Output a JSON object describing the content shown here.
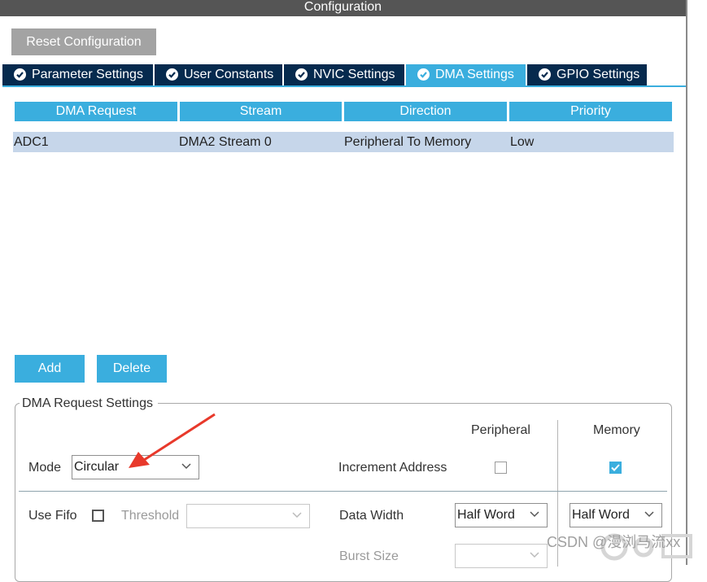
{
  "window": {
    "title": "Configuration"
  },
  "actions": {
    "reset_label": "Reset Configuration"
  },
  "tabs": [
    {
      "label": "Parameter Settings",
      "active": false
    },
    {
      "label": "User Constants",
      "active": false
    },
    {
      "label": "NVIC Settings",
      "active": false
    },
    {
      "label": "DMA Settings",
      "active": true
    },
    {
      "label": "GPIO Settings",
      "active": false
    }
  ],
  "dma_table": {
    "headers": [
      "DMA Request",
      "Stream",
      "Direction",
      "Priority"
    ],
    "rows": [
      {
        "request": "ADC1",
        "stream": "DMA2 Stream 0",
        "direction": "Peripheral To Memory",
        "priority": "Low"
      }
    ]
  },
  "table_buttons": {
    "add_label": "Add",
    "delete_label": "Delete"
  },
  "request_settings": {
    "title": "DMA Request Settings",
    "peripheral_header": "Peripheral",
    "memory_header": "Memory",
    "mode_label": "Mode",
    "mode_value": "Circular",
    "increment_label": "Increment Address",
    "increment_peripheral": false,
    "increment_memory": true,
    "use_fifo_label": "Use Fifo",
    "use_fifo": false,
    "threshold_label": "Threshold",
    "threshold_value": "",
    "data_width_label": "Data Width",
    "data_width_peripheral": "Half Word",
    "data_width_memory": "Half Word",
    "burst_size_label": "Burst Size",
    "burst_size_value": ""
  },
  "watermark": {
    "text": "CSDN @漫浏马流xx"
  },
  "colors": {
    "accent": "#3aaede",
    "tab_dark": "#062a4e",
    "selected_row": "#c6d6ea",
    "title_bar": "#555555",
    "disabled_button": "#a3a3a3"
  }
}
